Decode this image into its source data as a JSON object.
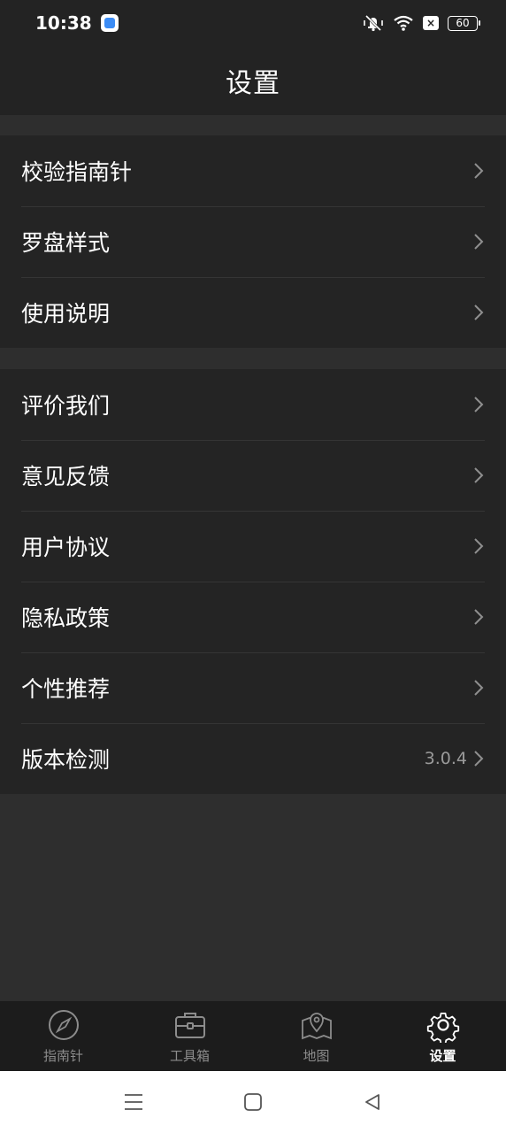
{
  "status_bar": {
    "time": "10:38",
    "battery": "60",
    "notif_badge": "×"
  },
  "header": {
    "title": "设置"
  },
  "groups": [
    {
      "items": [
        {
          "label": "校验指南针"
        },
        {
          "label": "罗盘样式"
        },
        {
          "label": "使用说明"
        }
      ]
    },
    {
      "items": [
        {
          "label": "评价我们"
        },
        {
          "label": "意见反馈"
        },
        {
          "label": "用户协议"
        },
        {
          "label": "隐私政策"
        },
        {
          "label": "个性推荐"
        },
        {
          "label": "版本检测",
          "value": "3.0.4"
        }
      ]
    }
  ],
  "tabs": [
    {
      "label": "指南针",
      "icon": "compass-icon"
    },
    {
      "label": "工具箱",
      "icon": "toolbox-icon"
    },
    {
      "label": "地图",
      "icon": "map-pin-icon"
    },
    {
      "label": "设置",
      "icon": "gear-icon",
      "active": true
    }
  ],
  "colors": {
    "background": "#2e2e2e",
    "header": "#232323",
    "card": "#242424",
    "tab_bar": "#1c1c1c",
    "text_inactive": "#8c8c8c"
  }
}
